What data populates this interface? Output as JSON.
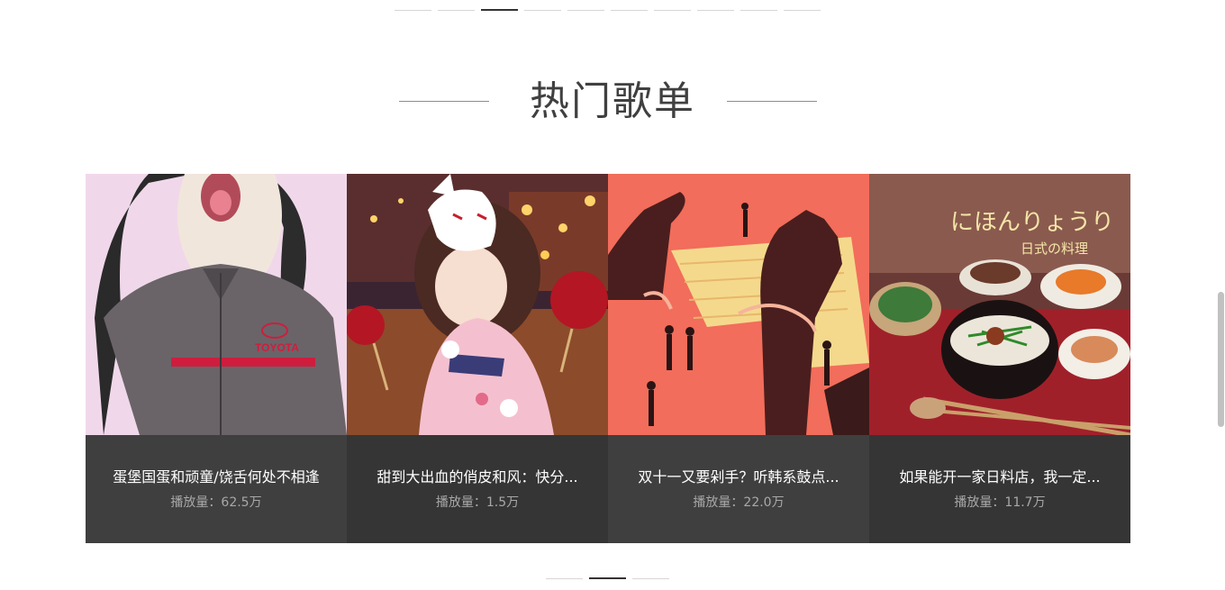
{
  "top_carousel": {
    "count": 10,
    "active_index": 2
  },
  "section": {
    "title": "热门歌单"
  },
  "playlists": [
    {
      "title": "蛋堡国蛋和顽童/饶舌何处不相逢",
      "plays": "播放量：62.5万",
      "cover": "anime-girl-portrait"
    },
    {
      "title": "甜到大出血的俏皮和风：快分...",
      "plays": "播放量：1.5万",
      "cover": "kimono-fox-mask-girl"
    },
    {
      "title": "双十一又要剁手？听韩系鼓点...",
      "plays": "播放量：22.0万",
      "cover": "handcuffed-hands-keyboard"
    },
    {
      "title": "如果能开一家日料店，我一定...",
      "plays": "播放量：11.7万",
      "cover": "japanese-cuisine",
      "cover_text": {
        "line1": "にほんりょうり",
        "line2": "日式の料理"
      }
    }
  ],
  "bottom_carousel": {
    "count": 3,
    "active_index": 1
  },
  "colors": {
    "accent": "#333333",
    "card_bg": "#3f3f3f",
    "card_bg_alt": "#353535"
  }
}
